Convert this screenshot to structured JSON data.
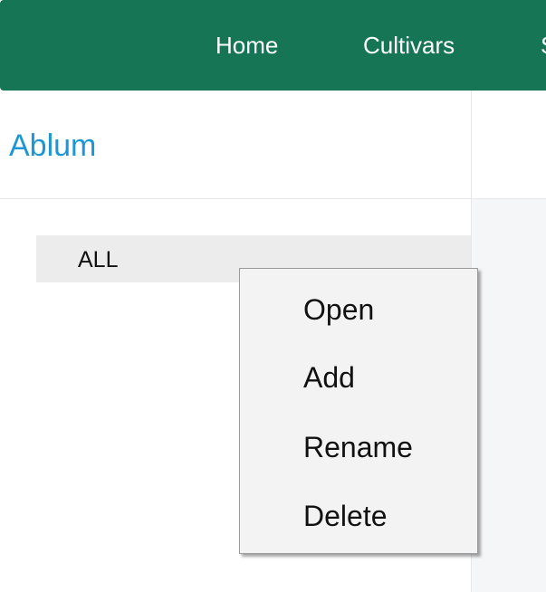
{
  "nav": {
    "items": [
      {
        "label": "Home"
      },
      {
        "label": "Cultivars"
      },
      {
        "label": "S"
      }
    ]
  },
  "sidebar": {
    "title": "Ablum",
    "tree": [
      {
        "label": "ALL"
      }
    ]
  },
  "context_menu": {
    "items": [
      {
        "label": "Open"
      },
      {
        "label": "Add"
      },
      {
        "label": "Rename"
      },
      {
        "label": "Delete"
      }
    ]
  },
  "colors": {
    "nav_background": "#157554",
    "title": "#1b96d6",
    "selected_row": "#ececec",
    "menu_background": "#f3f3f3"
  }
}
